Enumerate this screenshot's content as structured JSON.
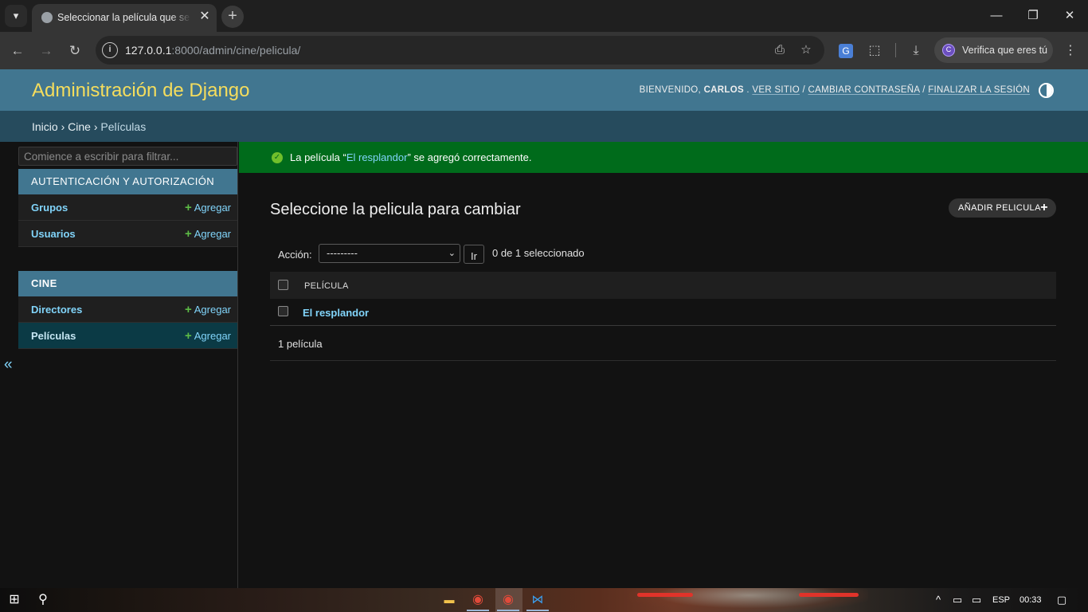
{
  "browser": {
    "tab_title": "Seleccionar la película que se va a modificar",
    "url_host": "127.0.0.1",
    "url_rest": ":8000/admin/cine/pelicula/",
    "profile_label": "Verifica que eres tú",
    "profile_initial": "C",
    "icons": {
      "tab_dropdown": "▾",
      "tab_close": "✕",
      "new_tab": "+",
      "minimize": "—",
      "restore": "❐",
      "close": "✕",
      "back": "←",
      "forward": "→",
      "reload": "↻",
      "site_info": "i",
      "translate": "⎙",
      "bookmark": "☆",
      "translate_ext": "G",
      "extensions": "⬚",
      "download": "⤓",
      "menu": "⋮"
    }
  },
  "header": {
    "branding": "Administración de Django",
    "welcome": "BIENVENIDO,",
    "username": "CARLOS",
    "dot": ".",
    "view_site": "VER SITIO",
    "change_password": "CAMBIAR CONTRASEÑA",
    "logout": "FINALIZAR LA SESIÓN",
    "slash": "/"
  },
  "breadcrumbs": {
    "home": "Inicio",
    "app": "Cine",
    "current": "Películas",
    "sep": "›"
  },
  "sidebar": {
    "filter_placeholder": "Comience a escribir para filtrar...",
    "collapse": "«",
    "add_plus": "+",
    "modules": [
      {
        "caption": "AUTENTICACIÓN Y AUTORIZACIÓN",
        "items": [
          {
            "label": "Grupos",
            "add": "Agregar"
          },
          {
            "label": "Usuarios",
            "add": "Agregar"
          }
        ]
      },
      {
        "caption": "CINE",
        "items": [
          {
            "label": "Directores",
            "add": "Agregar"
          },
          {
            "label": "Películas",
            "add": "Agregar"
          }
        ]
      }
    ]
  },
  "message": {
    "prefix": "La película “",
    "object": "El resplandor",
    "suffix": "” se agregó correctamente.",
    "icon": "✓"
  },
  "changelist": {
    "title": "Seleccione la pelicula para cambiar",
    "add_button": "AÑADIR PELICULA",
    "add_icon": "+",
    "action_label": "Acción:",
    "action_selected": "---------",
    "go_button": "Ir",
    "selection_count": "0 de 1 seleccionado",
    "column_header": "PELÍCULA",
    "rows": [
      "El resplandor"
    ],
    "paginator": "1 película"
  },
  "taskbar": {
    "language": "ESP",
    "time": "00:33",
    "icons": {
      "start": "⊞",
      "search": "⚲",
      "explorer": "▬",
      "chrome": "◉",
      "chrome2": "◉",
      "vscode": "⋈",
      "tray_up": "^",
      "network": "▭",
      "battery": "▭",
      "notifications": "▢"
    }
  }
}
